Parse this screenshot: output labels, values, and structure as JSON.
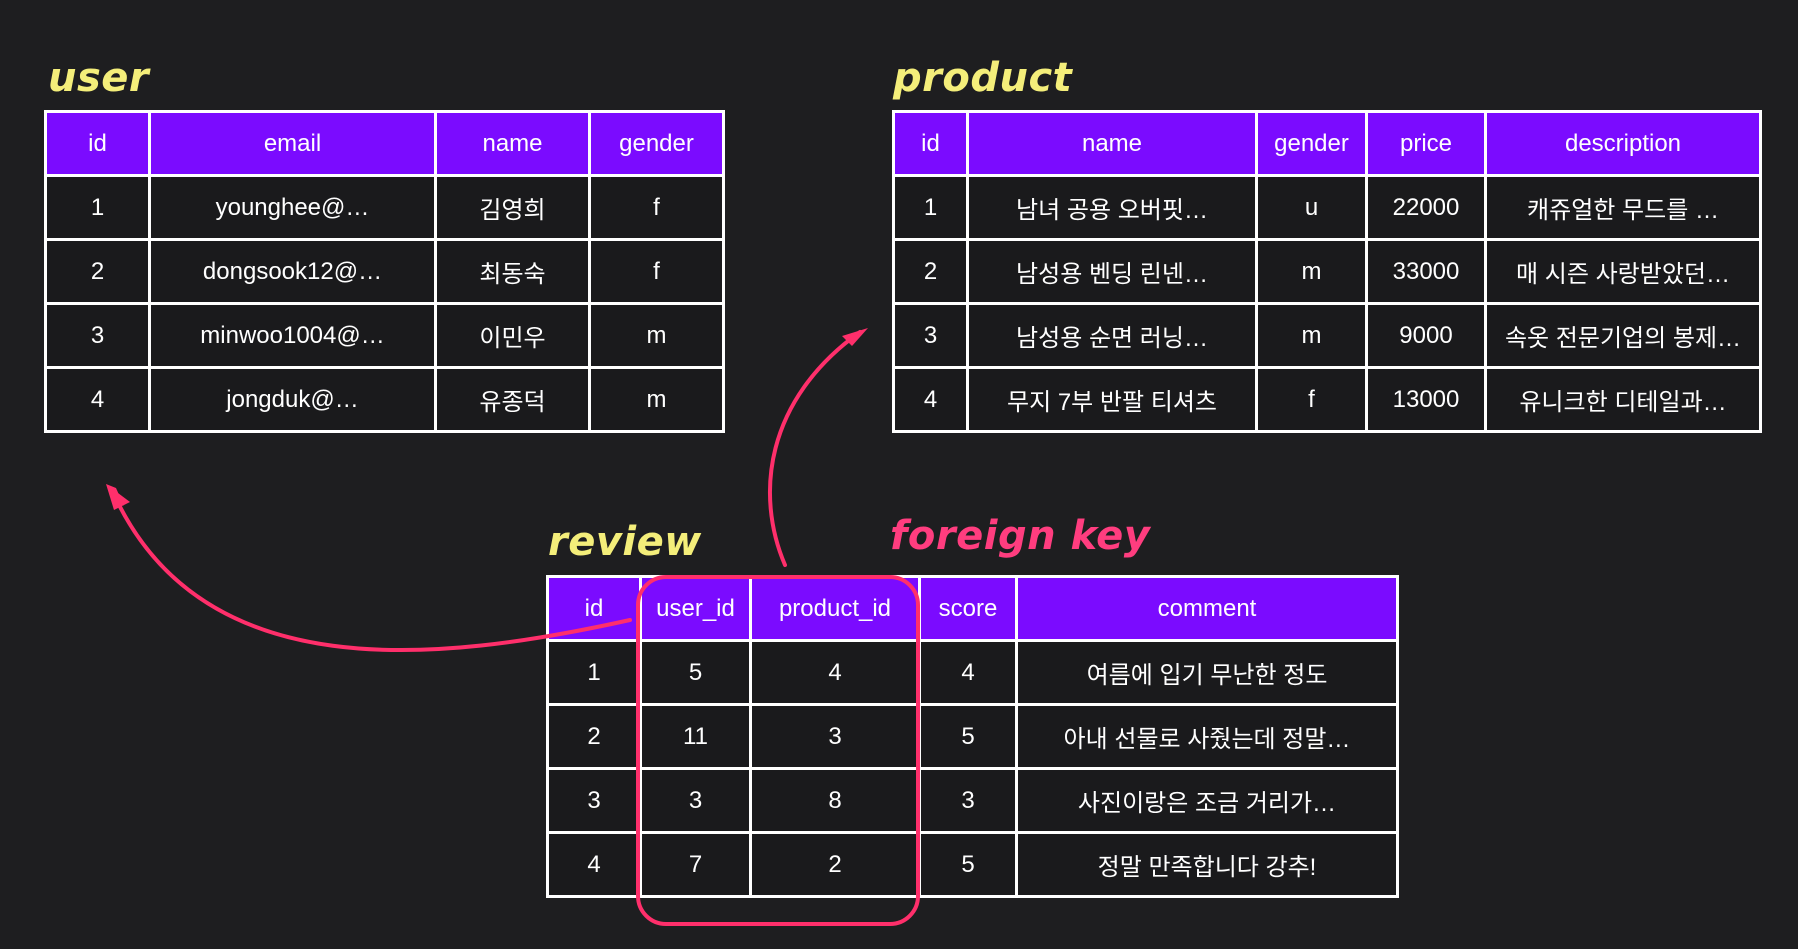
{
  "titles": {
    "user": "user",
    "product": "product",
    "review": "review",
    "foreign_key": "foreign key"
  },
  "user_table": {
    "headers": [
      "id",
      "email",
      "name",
      "gender"
    ],
    "rows": [
      [
        "1",
        "younghee@…",
        "김영희",
        "f"
      ],
      [
        "2",
        "dongsook12@…",
        "최동숙",
        "f"
      ],
      [
        "3",
        "minwoo1004@…",
        "이민우",
        "m"
      ],
      [
        "4",
        "jongduk@…",
        "유종덕",
        "m"
      ]
    ]
  },
  "product_table": {
    "headers": [
      "id",
      "name",
      "gender",
      "price",
      "description"
    ],
    "rows": [
      [
        "1",
        "남녀 공용 오버핏…",
        "u",
        "22000",
        "캐쥬얼한 무드를 …"
      ],
      [
        "2",
        "남성용 벤딩 린넨…",
        "m",
        "33000",
        "매 시즌 사랑받았던…"
      ],
      [
        "3",
        "남성용 순면 러닝…",
        "m",
        "9000",
        "속옷 전문기업의 봉제…"
      ],
      [
        "4",
        "무지 7부 반팔 티셔츠",
        "f",
        "13000",
        "유니크한 디테일과…"
      ]
    ]
  },
  "review_table": {
    "headers": [
      "id",
      "user_id",
      "product_id",
      "score",
      "comment"
    ],
    "rows": [
      [
        "1",
        "5",
        "4",
        "4",
        "여름에 입기 무난한 정도"
      ],
      [
        "2",
        "11",
        "3",
        "5",
        "아내 선물로 사줬는데 정말…"
      ],
      [
        "3",
        "3",
        "8",
        "3",
        "사진이랑은 조금 거리가…"
      ],
      [
        "4",
        "7",
        "2",
        "5",
        "정말 만족합니다 강추!"
      ]
    ]
  },
  "colors": {
    "background": "#1e1e20",
    "header_fill": "#7b0bff",
    "table_title": "#f4ee7a",
    "foreign_key": "#ff3d7f"
  }
}
